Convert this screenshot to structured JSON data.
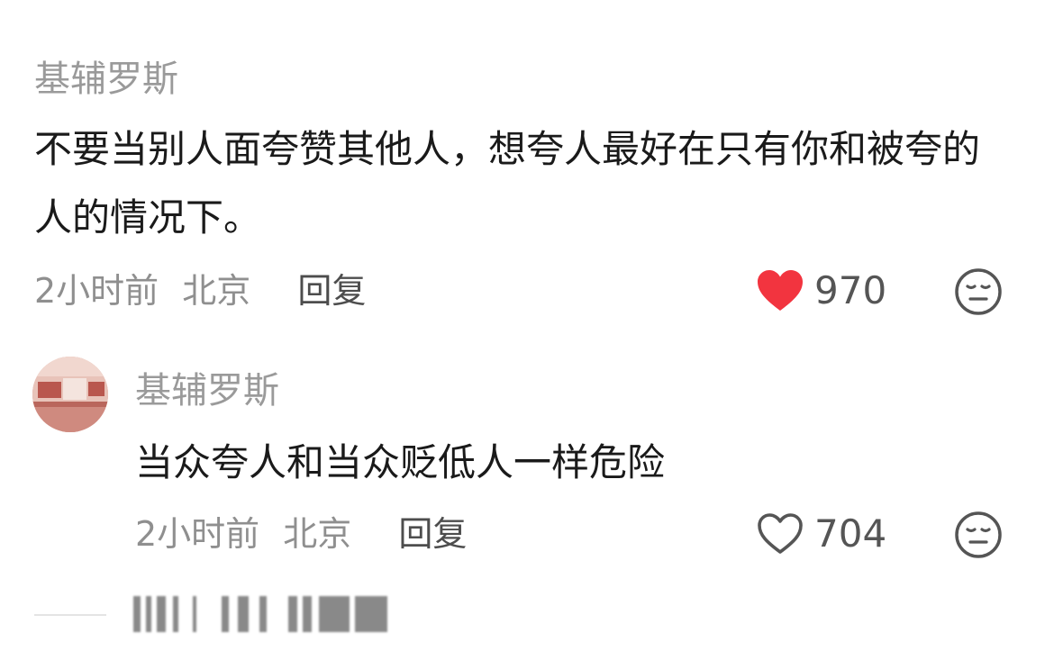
{
  "comments": [
    {
      "username": "基辅罗斯",
      "text": "不要当别人面夸赞其他人，想夸人最好在只有你和被夸的人的情况下。",
      "time": "2小时前",
      "location": "北京",
      "reply_label": "回复",
      "like_count": "970",
      "liked": true,
      "like_icon": "heart-filled-icon",
      "reaction_icon": "meh-face-icon"
    },
    {
      "username": "基辅罗斯",
      "text": "当众夸人和当众贬低人一样危险",
      "time": "2小时前",
      "location": "北京",
      "reply_label": "回复",
      "like_count": "704",
      "liked": false,
      "like_icon": "heart-outline-icon",
      "reaction_icon": "meh-face-icon"
    }
  ],
  "colors": {
    "like_active": "#f2343f",
    "like_inactive": "#555555",
    "username": "#9a9a9a",
    "meta": "#8f8f8f",
    "text": "#1a1a1a"
  }
}
